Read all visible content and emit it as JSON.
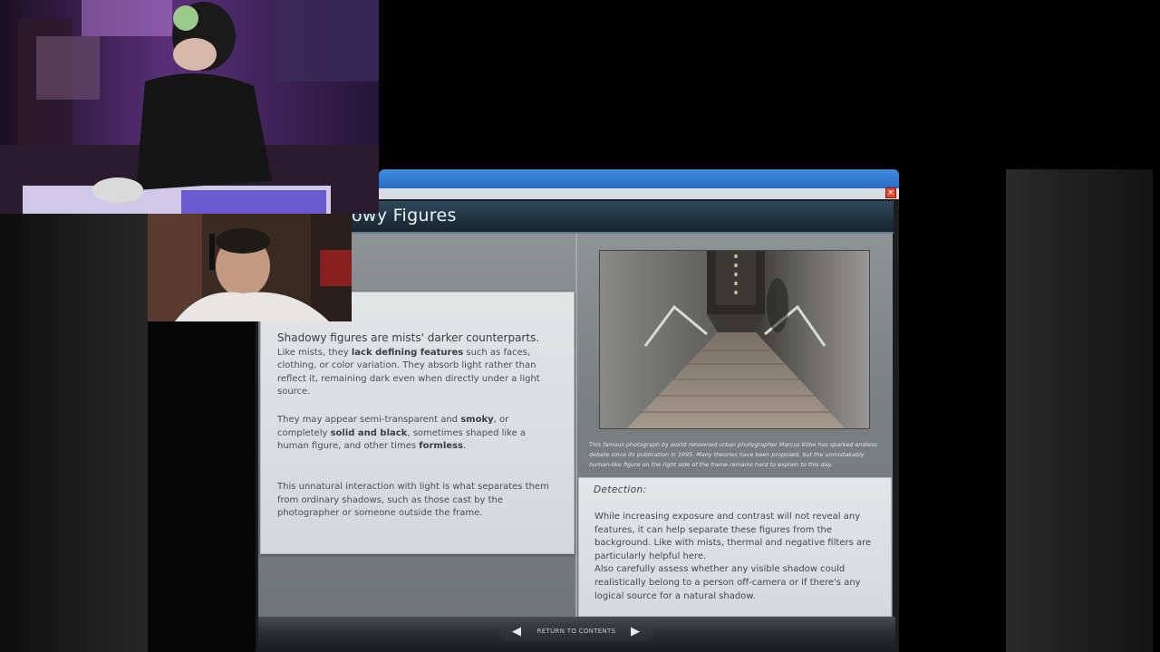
{
  "window": {
    "close_label": "×"
  },
  "page": {
    "title": "owy Figures",
    "paragraphs": [
      {
        "lead": "Shadowy figures are mists' darker counterparts.",
        "t1": " Like mists, they ",
        "b1": "lack defining features",
        "t2": " such as faces, clothing, or color variation. They absorb light rather than reflect it, remaining dark even when directly under a light source."
      },
      {
        "t1": "They may appear semi-transparent and ",
        "b1": "smoky",
        "t2": ", or completely ",
        "b2": "solid and black",
        "t3": ", sometimes shaped like a human figure, and other times ",
        "b3": "formless",
        "t4": "."
      },
      {
        "t1": "This unnatural interaction with light is what separates them from ordinary shadows, such as those cast by the photographer or someone outside the frame."
      }
    ],
    "photo_caption": "This famous photograph by world renowned urban photographer Marcus Kline has sparked endless debate since its publication in 1995. Many theories have been proposed, but the unmistakably human-like figure on the right side of the frame remains hard to explain to this day.",
    "detection": {
      "title": "Detection:",
      "line1": "While increasing exposure and contrast will not reveal any features, it can help separate these figures from the background. Like with mists, thermal and negative filters are particularly helpful here.",
      "line2": "Also carefully assess whether any visible shadow could realistically belong to a person off-camera or if there's any logical source for a natural shadow."
    }
  },
  "footer": {
    "prev_icon": "◀",
    "next_icon": "▶",
    "return_label": "RETURN TO CONTENTS"
  }
}
